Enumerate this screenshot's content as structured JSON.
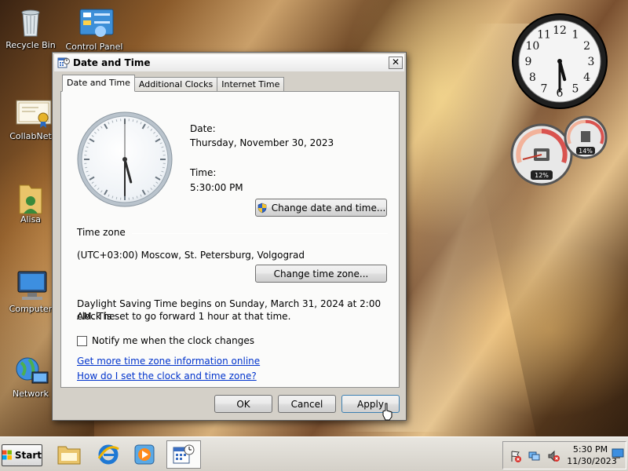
{
  "desktop": {
    "icons": [
      {
        "label": "Recycle Bin"
      },
      {
        "label": "Control Panel"
      },
      {
        "label": "CollabNet"
      },
      {
        "label": "Alisa"
      },
      {
        "label": "Computer"
      },
      {
        "label": "Network"
      }
    ]
  },
  "gadgets": {
    "clock": {
      "hour": 5,
      "minute": 30,
      "numerals": [
        "12",
        "1",
        "2",
        "3",
        "4",
        "5",
        "6",
        "7",
        "8",
        "9",
        "10",
        "11"
      ]
    },
    "meters": {
      "cpu_label": "12%",
      "memory_label": "14%"
    }
  },
  "dialog": {
    "title": "Date and Time",
    "close_label": "✕",
    "tabs": [
      {
        "label": "Date and Time",
        "active": true
      },
      {
        "label": "Additional Clocks",
        "active": false
      },
      {
        "label": "Internet Time",
        "active": false
      }
    ],
    "clock": {
      "hour": 5,
      "minute": 30,
      "second": 0
    },
    "date_label": "Date:",
    "date_value": "Thursday, November 30, 2023",
    "time_label": "Time:",
    "time_value": "5:30:00 PM",
    "change_datetime_label": "Change date and time...",
    "timezone_title": "Time zone",
    "timezone_value": "(UTC+03:00) Moscow, St. Petersburg, Volgograd",
    "change_timezone_label": "Change time zone...",
    "dst_line1": "Daylight Saving Time begins on Sunday, March 31, 2024 at 2:00 AM. The",
    "dst_line2": "clock is set to go forward 1 hour at that time.",
    "notify_label": "Notify me when the clock changes",
    "notify_checked": false,
    "link1": "Get more time zone information online",
    "link2": "How do I set the clock and time zone?",
    "ok_label": "OK",
    "cancel_label": "Cancel",
    "apply_label": "Apply"
  },
  "taskbar": {
    "start_label": "Start",
    "tray_time": "5:30 PM",
    "tray_date": "11/30/2023"
  },
  "colors": {
    "link": "#0033cc",
    "dialog_bg": "#d4d0c8",
    "panel_bg": "#fbfbfa"
  }
}
